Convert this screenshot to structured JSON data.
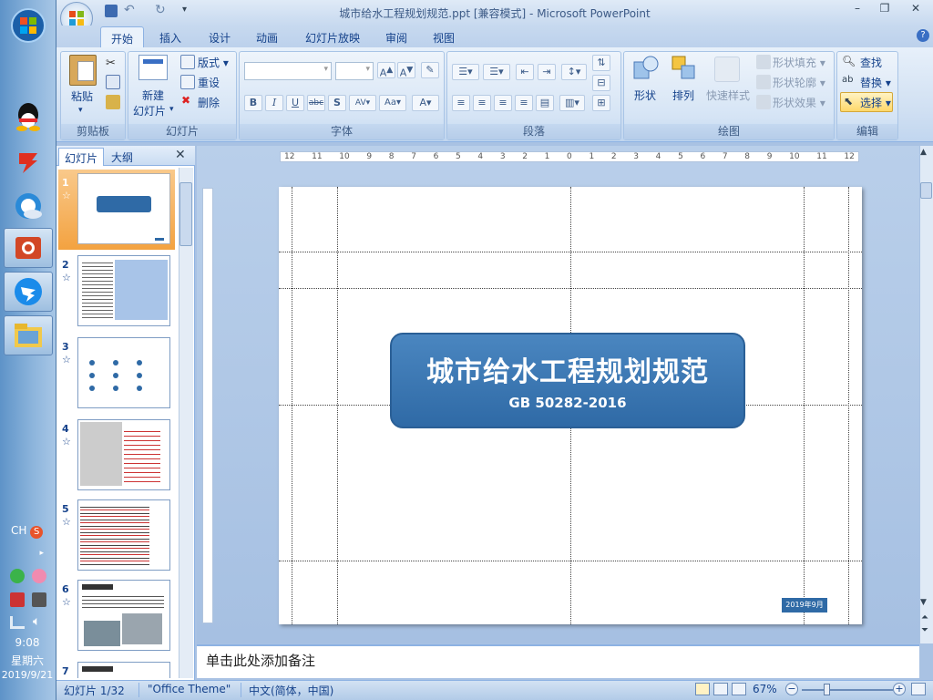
{
  "window": {
    "title": "城市给水工程规划规范.ppt [兼容模式] - Microsoft PowerPoint",
    "minimize_label": "–",
    "maximize_label": "❐",
    "close_label": "✕"
  },
  "tabs": [
    "开始",
    "插入",
    "设计",
    "动画",
    "幻灯片放映",
    "审阅",
    "视图"
  ],
  "ribbon": {
    "clipboard": {
      "label": "剪贴板",
      "paste": "粘贴"
    },
    "slides": {
      "label": "幻灯片",
      "new_slide_line1": "新建",
      "new_slide_line2": "幻灯片",
      "layout": "版式",
      "reset": "重设",
      "delete": "删除"
    },
    "font": {
      "label": "字体"
    },
    "paragraph": {
      "label": "段落"
    },
    "drawing": {
      "label": "绘图",
      "shapes": "形状",
      "arrange": "排列",
      "quick_styles": "快速样式",
      "shape_fill": "形状填充",
      "shape_outline": "形状轮廓",
      "shape_effects": "形状效果"
    },
    "editing": {
      "label": "编辑",
      "find": "查找",
      "replace": "替换",
      "select": "选择"
    }
  },
  "panel": {
    "tab_slides": "幻灯片",
    "tab_outline": "大纲",
    "slide_numbers": [
      "1",
      "2",
      "3",
      "4",
      "5",
      "6",
      "7"
    ],
    "star": "☆"
  },
  "slide": {
    "title": "城市给水工程规划规范",
    "subtitle": "GB 50282-2016",
    "date": "2019年9月"
  },
  "ruler": {
    "h_ticks": [
      "12",
      "11",
      "10",
      "9",
      "8",
      "7",
      "6",
      "5",
      "4",
      "3",
      "2",
      "1",
      "0",
      "1",
      "2",
      "3",
      "4",
      "5",
      "6",
      "7",
      "8",
      "9",
      "10",
      "11",
      "12"
    ]
  },
  "notes": {
    "placeholder": "单击此处添加备注"
  },
  "status": {
    "slide_info": "幻灯片 1/32",
    "theme": "\"Office Theme\"",
    "language": "中文(简体，中国)",
    "zoom": "67%",
    "zoom_level": 0.67
  },
  "taskbar": {
    "lang": "CH",
    "time": "9:08",
    "weekday": "星期六",
    "date": "2019/9/21"
  }
}
